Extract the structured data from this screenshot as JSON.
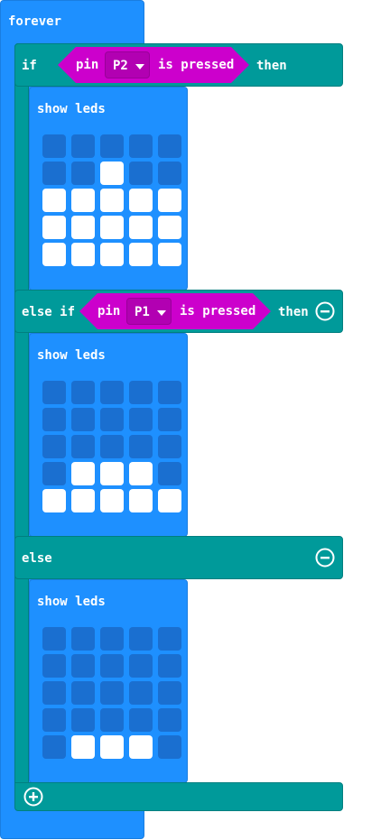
{
  "forever": {
    "label": "forever"
  },
  "if_block": {
    "if_label": "if",
    "then_label": "then",
    "else_if_label": "else if",
    "else_label": "else"
  },
  "condition_1": {
    "pin_label": "pin",
    "pin_value": "P2",
    "pressed_label": "is pressed"
  },
  "condition_2": {
    "pin_label": "pin",
    "pin_value": "P1",
    "pressed_label": "is pressed"
  },
  "show_leds": [
    {
      "label": "show leds",
      "grid": [
        [
          0,
          0,
          0,
          0,
          0
        ],
        [
          0,
          0,
          1,
          0,
          0
        ],
        [
          1,
          1,
          1,
          1,
          1
        ],
        [
          1,
          1,
          1,
          1,
          1
        ],
        [
          1,
          1,
          1,
          1,
          1
        ]
      ]
    },
    {
      "label": "show leds",
      "grid": [
        [
          0,
          0,
          0,
          0,
          0
        ],
        [
          0,
          0,
          0,
          0,
          0
        ],
        [
          0,
          0,
          0,
          0,
          0
        ],
        [
          0,
          1,
          1,
          1,
          0
        ],
        [
          1,
          1,
          1,
          1,
          1
        ]
      ]
    },
    {
      "label": "show leds",
      "grid": [
        [
          0,
          0,
          0,
          0,
          0
        ],
        [
          0,
          0,
          0,
          0,
          0
        ],
        [
          0,
          0,
          0,
          0,
          0
        ],
        [
          0,
          0,
          0,
          0,
          0
        ],
        [
          0,
          1,
          1,
          1,
          0
        ]
      ]
    }
  ],
  "colors": {
    "loops_blue": "#1e90ff",
    "logic_teal": "#009a9a",
    "pins_magenta": "#cc00cc",
    "led_off": "#1a6fd0",
    "led_on": "#ffffff"
  },
  "icons": {
    "remove": "minus-circle-icon",
    "add": "plus-circle-icon",
    "dropdown": "caret-down-icon"
  }
}
